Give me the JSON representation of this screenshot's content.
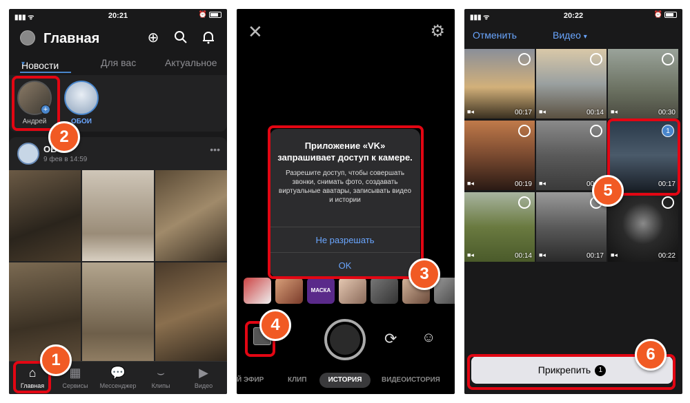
{
  "status": {
    "time1": "20:21",
    "time2": "",
    "time3": "20:22"
  },
  "feed": {
    "title": "Главная",
    "tabs": [
      "Новости",
      "Для вас",
      "Актуальное"
    ],
    "stories": [
      {
        "label": "Андрей"
      },
      {
        "label": "ОБОИ"
      }
    ],
    "post": {
      "author": "ОБ",
      "date": "9 фев в 14:59"
    },
    "nav": [
      "Главная",
      "Сервисы",
      "Мессенджер",
      "Клипы",
      "Видео"
    ]
  },
  "camera": {
    "dialog": {
      "title": "Приложение «VK» запрашивает доступ к камере.",
      "text": "Разрешите доступ, чтобы совершать звонки, снимать фото, создавать виртуальные аватары, записывать видео и истории",
      "deny": "Не разрешать",
      "ok": "OK"
    },
    "mask_label": "МАСКА",
    "modes": [
      "Й ЭФИР",
      "КЛИП",
      "ИСТОРИЯ",
      "ВИДЕОИСТОРИЯ"
    ]
  },
  "picker": {
    "cancel": "Отменить",
    "filter": "Видео",
    "durations": [
      "00:17",
      "00:14",
      "00:30",
      "00:19",
      "00:17",
      "00:17",
      "00:14",
      "00:17",
      "00:22"
    ],
    "selected_index": "1",
    "attach_label": "Прикрепить",
    "attach_count": "1"
  },
  "callouts": [
    "1",
    "2",
    "3",
    "4",
    "5",
    "6"
  ],
  "colors": {
    "accent": "#4986cc",
    "highlight": "#e30613",
    "callout": "#f15a24"
  }
}
